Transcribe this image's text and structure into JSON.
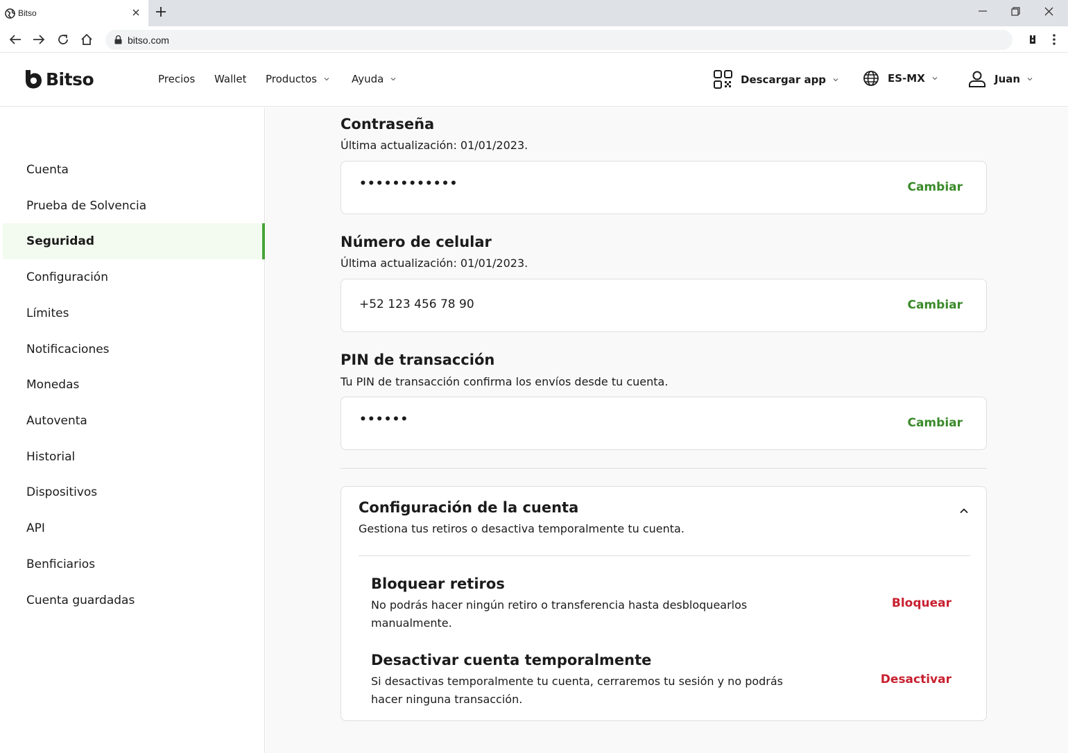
{
  "browser": {
    "tab_title": "Bitso",
    "url": "bitso.com"
  },
  "header": {
    "brand": "Bitso",
    "nav": [
      {
        "label": "Precios"
      },
      {
        "label": "Wallet"
      },
      {
        "label": "Productos"
      },
      {
        "label": "Ayuda"
      }
    ],
    "download_app": "Descargar app",
    "language": "ES-MX",
    "user": "Juan"
  },
  "sidebar": {
    "items": [
      {
        "label": "Cuenta"
      },
      {
        "label": "Prueba de Solvencia"
      },
      {
        "label": "Seguridad",
        "active": true
      },
      {
        "label": "Configuración"
      },
      {
        "label": "Límites"
      },
      {
        "label": "Notificaciones"
      },
      {
        "label": "Monedas"
      },
      {
        "label": "Autoventa"
      },
      {
        "label": "Historial"
      },
      {
        "label": "Dispositivos"
      },
      {
        "label": "API"
      },
      {
        "label": "Benficiarios"
      },
      {
        "label": "Cuenta guardadas"
      }
    ]
  },
  "security": {
    "password": {
      "title": "Contraseña",
      "subtitle": "Última actualización: 01/01/2023.",
      "value": "••••••••••••",
      "action": "Cambiar"
    },
    "phone": {
      "title": "Número de celular",
      "subtitle": "Última actualización: 01/01/2023.",
      "value": "+52 123 456 78 90",
      "action": "Cambiar"
    },
    "pin": {
      "title": "PIN de transacción",
      "subtitle": "Tu PIN de transacción confirma los envíos desde tu cuenta.",
      "value": "••••••",
      "action": "Cambiar"
    }
  },
  "account_config": {
    "title": "Configuración de la cuenta",
    "subtitle": "Gestiona tus retiros o desactiva temporalmente tu cuenta.",
    "expanded": true,
    "block_withdrawals": {
      "title": "Bloquear retiros",
      "description": "No podrás hacer ningún retiro o transferencia hasta desbloquearlos manualmente.",
      "action": "Bloquear"
    },
    "deactivate": {
      "title": "Desactivar cuenta temporalmente",
      "description": "Si desactivas temporalmente tu cuenta, cerraremos tu sesión y no podrás hacer ninguna transacción.",
      "action": "Desactivar"
    }
  },
  "colors": {
    "accent_green": "#3a8a2a",
    "active_bar": "#49a339",
    "danger_red": "#c8202f"
  }
}
